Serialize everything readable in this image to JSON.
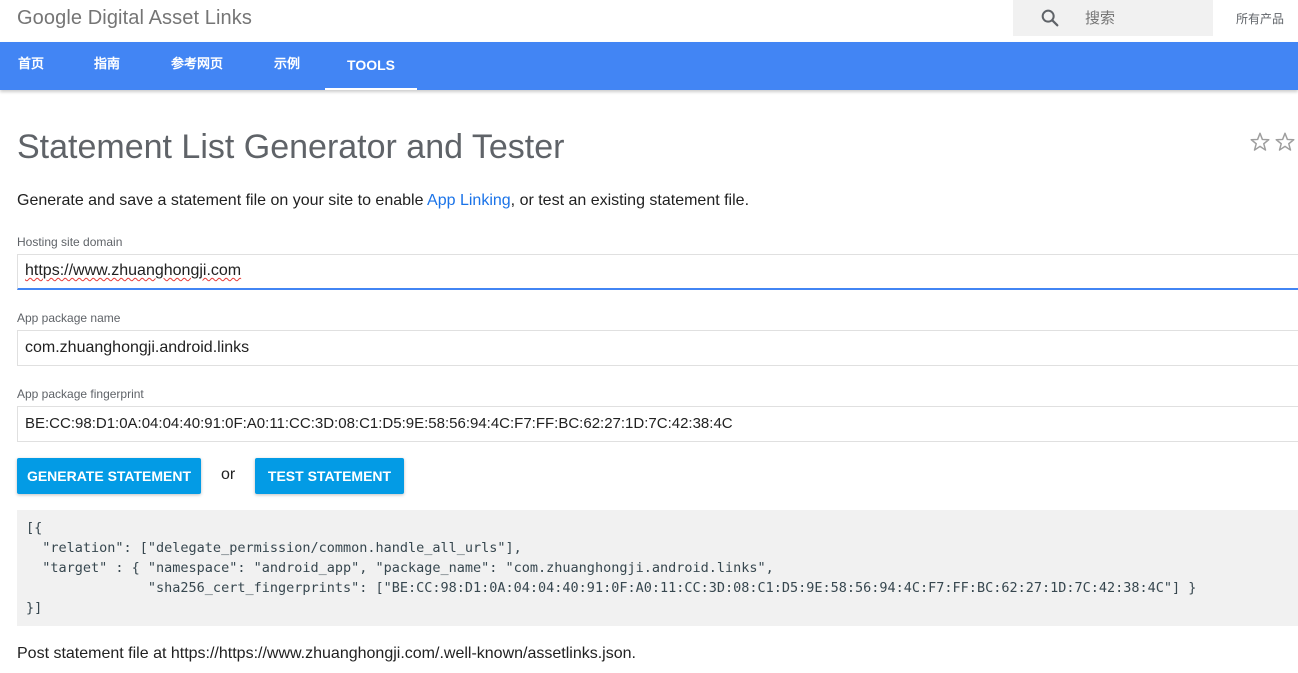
{
  "header": {
    "brand": "Google Digital Asset Links",
    "search_placeholder": "搜索",
    "all_products": "所有产品"
  },
  "nav": {
    "tabs": [
      {
        "label": "首页",
        "active": false
      },
      {
        "label": "指南",
        "active": false
      },
      {
        "label": "参考网页",
        "active": false
      },
      {
        "label": "示例",
        "active": false
      },
      {
        "label": "TOOLS",
        "active": true
      }
    ]
  },
  "main": {
    "title": "Statement List Generator and Tester",
    "intro_before": "Generate and save a statement file on your site to enable ",
    "intro_link": "App Linking",
    "intro_after": ", or test an existing statement file.",
    "fields": [
      {
        "label": "Hosting site domain",
        "value": "https://www.zhuanghongji.com"
      },
      {
        "label": "App package name",
        "value": "com.zhuanghongji.android.links"
      },
      {
        "label": "App package fingerprint",
        "value": "BE:CC:98:D1:0A:04:04:40:91:0F:A0:11:CC:3D:08:C1:D5:9E:58:56:94:4C:F7:FF:BC:62:27:1D:7C:42:38:4C"
      }
    ],
    "generate_button": "GENERATE STATEMENT",
    "or_text": "or",
    "test_button": "TEST STATEMENT",
    "code": "[{\n  \"relation\": [\"delegate_permission/common.handle_all_urls\"],\n  \"target\" : { \"namespace\": \"android_app\", \"package_name\": \"com.zhuanghongji.android.links\",\n               \"sha256_cert_fingerprints\": [\"BE:CC:98:D1:0A:04:04:40:91:0F:A0:11:CC:3D:08:C1:D5:9E:58:56:94:4C:F7:FF:BC:62:27:1D:7C:42:38:4C\"] }\n}]",
    "post_text": "Post statement file at https://https://www.zhuanghongji.com/.well-known/assetlinks.json."
  },
  "colors": {
    "nav_bg": "#4285f4",
    "button_bg": "#039be5",
    "link": "#1a73e8"
  },
  "icons": [
    "search-icon",
    "star-outline-icon"
  ]
}
